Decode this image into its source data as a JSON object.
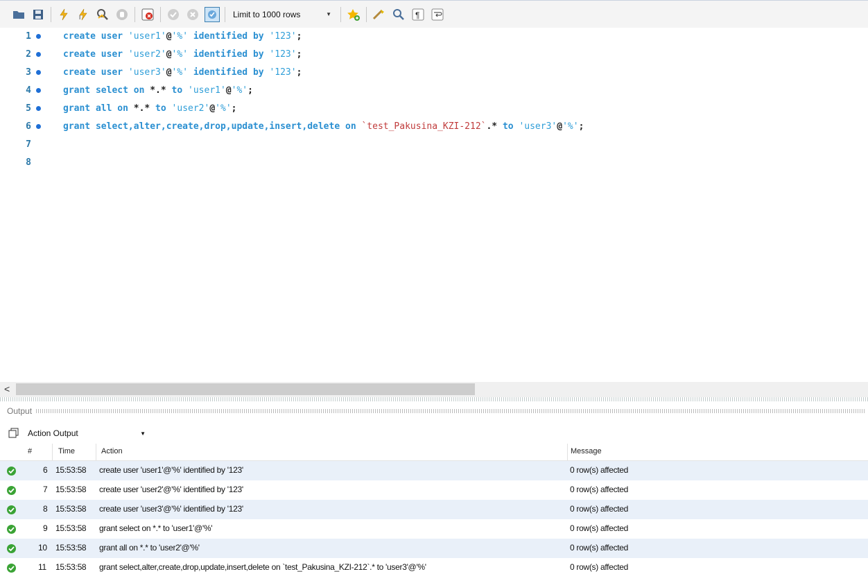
{
  "toolbar": {
    "limit_label": "Limit to 1000 rows",
    "icons": [
      "open-file-icon",
      "save-icon",
      "execute-icon",
      "execute-current-icon",
      "explain-icon",
      "stop-icon",
      "toggle-error-icon",
      "commit-icon",
      "rollback-icon",
      "autocommit-icon",
      "limit-select",
      "add-snippet-icon",
      "beautify-icon",
      "find-icon",
      "invisible-chars-icon",
      "wrap-icon"
    ]
  },
  "editor": {
    "line_numbers": [
      "1",
      "2",
      "3",
      "4",
      "5",
      "6",
      "7",
      "8"
    ],
    "lines": [
      {
        "kw1": "create user ",
        "str": "'user1'",
        "at": "@",
        "str2": "'%'",
        "kw2": " identified by ",
        "str3": "'123'",
        "end": ";"
      },
      {
        "kw1": "create user ",
        "str": "'user2'",
        "at": "@",
        "str2": "'%'",
        "kw2": " identified by ",
        "str3": "'123'",
        "end": ";"
      },
      {
        "kw1": "create user ",
        "str": "'user3'",
        "at": "@",
        "str2": "'%'",
        "kw2": " identified by ",
        "str3": "'123'",
        "end": ";"
      },
      {
        "kw1": "grant select on ",
        "plain": "*.*",
        "kw2": " to ",
        "str": "'user1'",
        "at": "@",
        "str2": "'%'",
        "end": ";"
      },
      {
        "kw1": "grant all on ",
        "plain": "*.*",
        "kw2": " to ",
        "str": "'user2'",
        "at": "@",
        "str2": "'%'",
        "end": ";"
      },
      {
        "kw1": "grant select,alter,create,drop,update,insert,delete on ",
        "ident": "`test_Pakusina_KZI-212`",
        "plain": ".*",
        "kw2": " to ",
        "str": "'user3'",
        "at": "@",
        "str2": "'%'",
        "end": ";"
      }
    ]
  },
  "output": {
    "title": "Output",
    "selector": "Action Output",
    "columns": [
      "#",
      "Time",
      "Action",
      "Message"
    ],
    "rows": [
      {
        "num": "6",
        "time": "15:53:58",
        "action": "create user 'user1'@'%' identified by '123'",
        "message": "0 row(s) affected"
      },
      {
        "num": "7",
        "time": "15:53:58",
        "action": "create user 'user2'@'%' identified by '123'",
        "message": "0 row(s) affected"
      },
      {
        "num": "8",
        "time": "15:53:58",
        "action": "create user 'user3'@'%' identified by '123'",
        "message": "0 row(s) affected"
      },
      {
        "num": "9",
        "time": "15:53:58",
        "action": "grant select on *.* to 'user1'@'%'",
        "message": "0 row(s) affected"
      },
      {
        "num": "10",
        "time": "15:53:58",
        "action": "grant all on *.* to 'user2'@'%'",
        "message": "0 row(s) affected"
      },
      {
        "num": "11",
        "time": "15:53:58",
        "action": "grant select,alter,create,drop,update,insert,delete on `test_Pakusina_KZI-212`.* to 'user3'@'%'",
        "message": "0 row(s) affected"
      }
    ]
  },
  "scrollbar": {
    "left_arrow": "<"
  },
  "colors": {
    "accent": "#1f6fd6",
    "success": "#3aa335",
    "alt_row": "#e9f0f9"
  }
}
